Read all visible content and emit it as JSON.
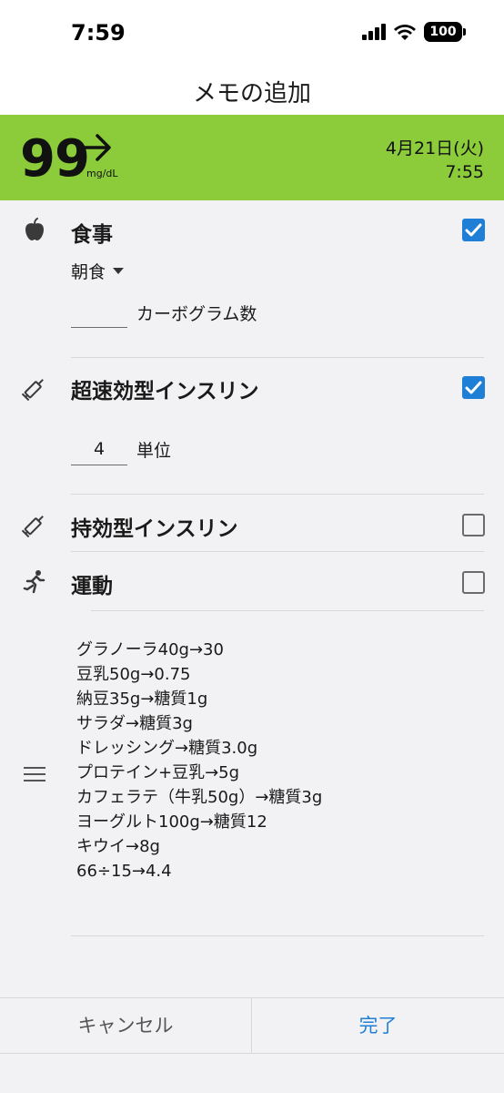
{
  "status_bar": {
    "time": "7:59",
    "battery": "100"
  },
  "nav": {
    "title": "メモの追加"
  },
  "glucose": {
    "value": "99",
    "unit": "mg/dL",
    "trend": "arrow-right",
    "date": "4月21日(火)",
    "time": "7:55",
    "accent_color": "#8ccb3a"
  },
  "meal": {
    "label": "食事",
    "checked": true,
    "type_select": "朝食",
    "carbs_value": "",
    "carbs_label": "カーボグラム数"
  },
  "rapid_insulin": {
    "label": "超速効型インスリン",
    "checked": true,
    "units_value": "4",
    "units_label": "単位"
  },
  "long_insulin": {
    "label": "持効型インスリン",
    "checked": false
  },
  "exercise": {
    "label": "運動",
    "checked": false
  },
  "notes": {
    "lines": [
      "グラノーラ40g→30",
      "豆乳50g→0.75",
      "納豆35g→糖質1g",
      "サラダ→糖質3g",
      "ドレッシング→糖質3.0g",
      "プロテイン+豆乳→5g",
      "カフェラテ（牛乳50g）→糖質3g",
      "ヨーグルト100g→糖質12",
      "キウイ→8g",
      "",
      "66÷15→4.4"
    ]
  },
  "footer": {
    "cancel_label": "キャンセル",
    "done_label": "完了"
  },
  "colors": {
    "checkbox_on": "#1f7fd6",
    "done_text": "#1f7fd6"
  }
}
